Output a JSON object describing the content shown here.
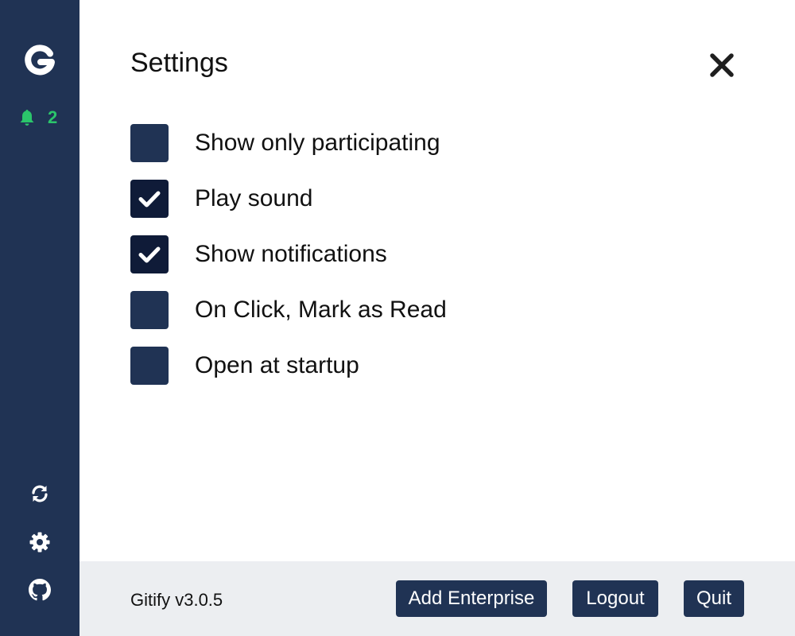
{
  "sidebar": {
    "logo_icon": "gitify-logo",
    "notifications": {
      "icon": "bell-icon",
      "count": "2",
      "color": "#2bc56b"
    },
    "actions": [
      {
        "name": "refresh",
        "icon": "refresh-icon"
      },
      {
        "name": "settings",
        "icon": "gear-icon"
      },
      {
        "name": "github",
        "icon": "github-icon"
      }
    ],
    "background": "#203354"
  },
  "settings": {
    "title": "Settings",
    "close_icon": "close-icon",
    "options": [
      {
        "label": "Show only participating",
        "checked": false
      },
      {
        "label": "Play sound",
        "checked": true
      },
      {
        "label": "Show notifications",
        "checked": true
      },
      {
        "label": "On Click, Mark as Read",
        "checked": false
      },
      {
        "label": "Open at startup",
        "checked": false
      }
    ]
  },
  "footer": {
    "version": "Gitify v3.0.5",
    "add_enterprise_label": "Add Enterprise",
    "logout_label": "Logout",
    "quit_label": "Quit",
    "background": "#eceef1",
    "button_color": "#203354"
  }
}
